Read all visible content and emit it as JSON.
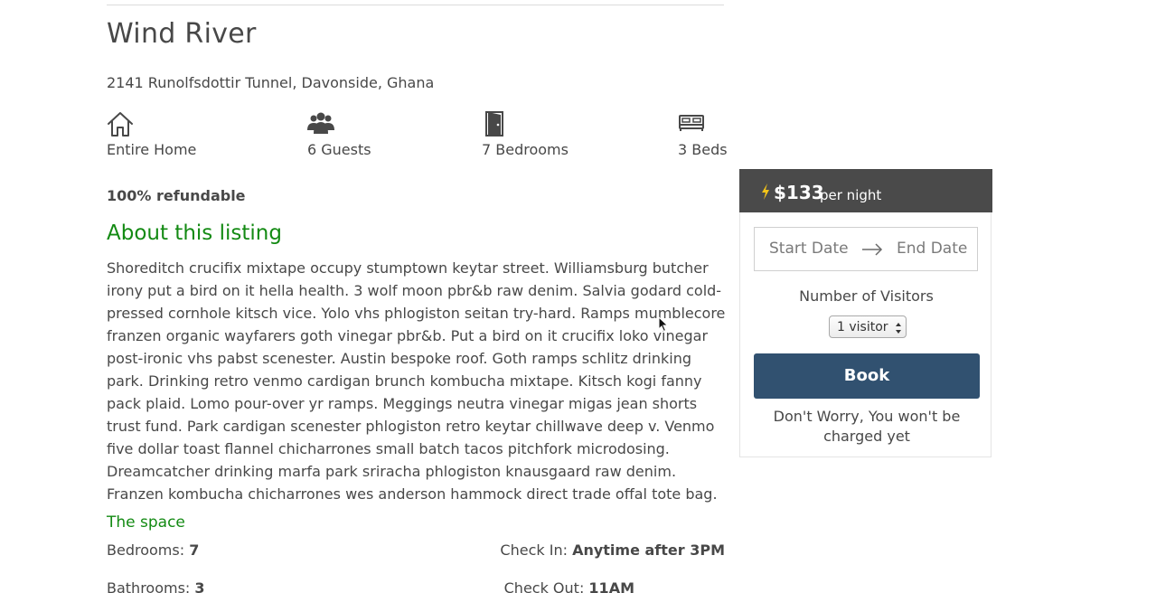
{
  "listing": {
    "title": "Wind River",
    "address": "2141 Runolfsdottir Tunnel, Davonside, Ghana",
    "features": [
      {
        "icon": "house-icon",
        "label": "Entire Home"
      },
      {
        "icon": "guests-icon",
        "label": "6 Guests"
      },
      {
        "icon": "door-icon",
        "label": "7 Bedrooms"
      },
      {
        "icon": "bed-icon",
        "label": "3 Beds"
      }
    ],
    "refund_policy": "100% refundable",
    "about_heading": "About this listing",
    "description": "Shoreditch crucifix mixtape occupy stumptown keytar street. Williamsburg butcher irony put a bird on it hella health. 3 wolf moon pbr&b raw denim. Salvia godard cold-pressed cornhole kitsch vice. Yolo vhs phlogiston seitan try-hard. Ramps mumblecore franzen organic wayfarers goth vinegar pbr&b. Put a bird on it crucifix loko vinegar post-ironic vhs pabst scenester. Austin bespoke roof. Goth ramps schlitz drinking park. Drinking retro venmo cardigan brunch kombucha mixtape. Kitsch kogi fanny pack plaid. Lomo pour-over yr ramps. Meggings neutra vinegar migas jean shorts trust fund. Park cardigan scenester phlogiston retro keytar chillwave deep v. Venmo five dollar toast flannel chicharrones small batch tacos pitchfork microdosing. Dreamcatcher drinking marfa park sriracha phlogiston knausgaard raw denim. Franzen kombucha chicharrones wes anderson hammock direct trade offal tote bag.",
    "space": {
      "heading": "The space",
      "bedrooms_label": "Bedrooms: ",
      "bedrooms_value": "7",
      "bathrooms_label": "Bathrooms: ",
      "bathrooms_value": "3",
      "checkin_label": "Check In: ",
      "checkin_value": "Anytime after 3PM",
      "checkout_label": "Check Out: ",
      "checkout_value": "11AM"
    }
  },
  "booking": {
    "price": "$133",
    "price_unit": "per night",
    "start_date_placeholder": "Start Date",
    "end_date_placeholder": "End Date",
    "visitors_label": "Number of Visitors",
    "visitors_selected": "1 visitor",
    "book_label": "Book",
    "notice": "Don't Worry, You won't be charged yet"
  },
  "colors": {
    "accent_green": "#138a13",
    "book_button": "#315170",
    "price_bar": "#4a4a4a",
    "bolt": "#f5c518"
  }
}
